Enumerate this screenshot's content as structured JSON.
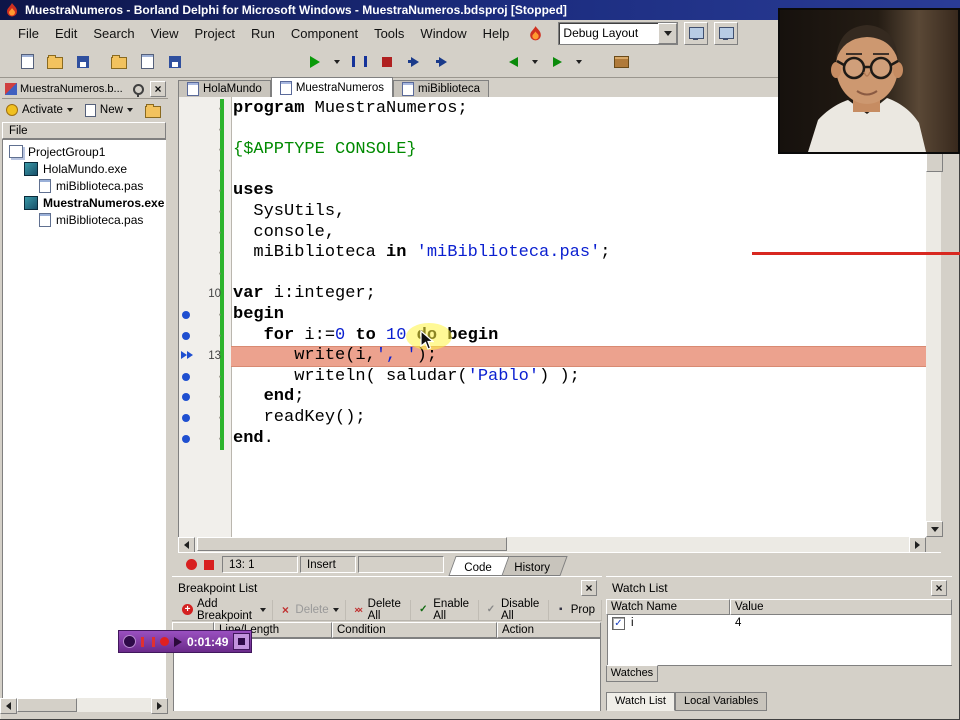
{
  "titlebar": {
    "title": "MuestraNumeros - Borland Delphi for Microsoft Windows - MuestraNumeros.bdsproj [Stopped]"
  },
  "menubar": {
    "items": [
      "File",
      "Edit",
      "Search",
      "View",
      "Project",
      "Run",
      "Component",
      "Tools",
      "Window",
      "Help"
    ],
    "layout_combo": "Debug Layout"
  },
  "toolbar": {
    "groups": [
      [
        {
          "name": "new-file-icon",
          "shape": "page"
        },
        {
          "name": "open-file-icon",
          "shape": "folder"
        },
        {
          "name": "save-file-icon",
          "shape": "floppy"
        }
      ],
      [
        {
          "name": "open-project-icon",
          "shape": "folder"
        },
        {
          "name": "add-file-icon",
          "shape": "page"
        },
        {
          "name": "save-all-icon",
          "shape": "floppy"
        }
      ],
      [
        {
          "name": "run-icon",
          "shape": "run",
          "caret": true
        },
        {
          "name": "pause-icon",
          "shape": "pause"
        },
        {
          "name": "program-reset-icon",
          "shape": "stop"
        },
        {
          "name": "step-over-icon",
          "shape": "step"
        },
        {
          "name": "trace-into-icon",
          "shape": "step"
        }
      ],
      [
        {
          "name": "navigate-back-icon",
          "shape": "back",
          "caret": true
        },
        {
          "name": "navigate-forward-icon",
          "shape": "fwd",
          "caret": true
        }
      ],
      [
        {
          "name": "package-icon",
          "shape": "package"
        }
      ]
    ]
  },
  "project_panel": {
    "title": "MuestraNumeros.b...",
    "toolbar_buttons": [
      "Activate",
      "New"
    ],
    "column_header": "File",
    "tree": [
      {
        "label": "ProjectGroup1",
        "level": 0,
        "icon": "project-group-icon",
        "bold": false
      },
      {
        "label": "HolaMundo.exe",
        "level": 1,
        "icon": "exe-icon",
        "bold": false
      },
      {
        "label": "miBiblioteca.pas",
        "level": 2,
        "icon": "pas-icon",
        "bold": false
      },
      {
        "label": "MuestraNumeros.exe",
        "level": 1,
        "icon": "exe-icon",
        "bold": true
      },
      {
        "label": "miBiblioteca.pas",
        "level": 2,
        "icon": "pas-icon",
        "bold": false
      }
    ]
  },
  "editor": {
    "tabs": [
      {
        "label": "HolaMundo",
        "active": false
      },
      {
        "label": "MuestraNumeros",
        "active": true
      },
      {
        "label": "miBiblioteca",
        "active": false
      }
    ],
    "code": {
      "gutter_dot": "·",
      "lines": [
        {
          "g": "",
          "m": "",
          "hl": false,
          "segs": [
            [
              "k",
              "program"
            ],
            [
              "i",
              " MuestraNumeros;"
            ]
          ]
        },
        {
          "g": "",
          "m": "",
          "hl": false,
          "segs": []
        },
        {
          "g": "",
          "m": "",
          "hl": false,
          "segs": [
            [
              "d",
              "{$APPTYPE CONSOLE}"
            ]
          ]
        },
        {
          "g": "",
          "m": "",
          "hl": false,
          "segs": []
        },
        {
          "g": "",
          "m": "",
          "hl": false,
          "segs": [
            [
              "k",
              "uses"
            ]
          ]
        },
        {
          "g": "",
          "m": "",
          "hl": false,
          "segs": [
            [
              "i",
              "  SysUtils,"
            ]
          ]
        },
        {
          "g": "",
          "m": "",
          "hl": false,
          "segs": [
            [
              "i",
              "  console,"
            ]
          ]
        },
        {
          "g": "",
          "m": "",
          "hl": false,
          "segs": [
            [
              "i",
              "  miBiblioteca "
            ],
            [
              "k",
              "in"
            ],
            [
              "i",
              " "
            ],
            [
              "s",
              "'miBiblioteca.pas'"
            ],
            [
              "i",
              ";"
            ]
          ]
        },
        {
          "g": "",
          "m": "",
          "hl": false,
          "segs": []
        },
        {
          "g": "10",
          "m": "",
          "hl": false,
          "segs": [
            [
              "k",
              "var"
            ],
            [
              "i",
              " i:integer;"
            ]
          ]
        },
        {
          "g": "",
          "m": "dot",
          "hl": false,
          "segs": [
            [
              "k",
              "begin"
            ]
          ]
        },
        {
          "g": "",
          "m": "dot",
          "hl": false,
          "segs": [
            [
              "i",
              "   "
            ],
            [
              "k",
              "for"
            ],
            [
              "i",
              " i:="
            ],
            [
              "n",
              "0"
            ],
            [
              "i",
              " "
            ],
            [
              "k",
              "to"
            ],
            [
              "i",
              " "
            ],
            [
              "n",
              "10"
            ],
            [
              "i",
              " "
            ],
            [
              "k",
              "do"
            ],
            [
              "i",
              " "
            ],
            [
              "k",
              "begin"
            ]
          ]
        },
        {
          "g": "13",
          "m": "arrow",
          "hl": true,
          "segs": [
            [
              "i",
              "      write(i,"
            ],
            [
              "s",
              "', '"
            ],
            [
              "i",
              ");"
            ]
          ]
        },
        {
          "g": "",
          "m": "dot",
          "hl": false,
          "segs": [
            [
              "i",
              "      writeln( saludar("
            ],
            [
              "s",
              "'Pablo'"
            ],
            [
              "i",
              ") );"
            ]
          ]
        },
        {
          "g": "",
          "m": "dot",
          "hl": false,
          "segs": [
            [
              "i",
              "   "
            ],
            [
              "k",
              "end"
            ],
            [
              "i",
              ";"
            ]
          ]
        },
        {
          "g": "",
          "m": "dot",
          "hl": false,
          "segs": [
            [
              "i",
              "   readKey();"
            ]
          ]
        },
        {
          "g": "",
          "m": "dot",
          "hl": false,
          "segs": [
            [
              "k",
              "end"
            ],
            [
              "i",
              "."
            ]
          ]
        }
      ]
    },
    "status": {
      "caret": "13: 1",
      "mode": "Insert"
    },
    "bottom_tabs": [
      "Code",
      "History"
    ]
  },
  "breakpoint_panel": {
    "title": "Breakpoint List",
    "toolbar": [
      {
        "label": "Add Breakpoint",
        "icon": "add-breakpoint-icon",
        "ic": "plus",
        "caret": true,
        "disabled": false
      },
      {
        "label": "Delete",
        "icon": "delete-breakpoint-icon",
        "ic": "x",
        "caret": true,
        "disabled": true
      },
      {
        "label": "Delete All",
        "icon": "delete-all-icon",
        "ic": "xx",
        "caret": false,
        "disabled": false
      },
      {
        "label": "Enable All",
        "icon": "enable-all-icon",
        "ic": "check",
        "caret": false,
        "disabled": false
      },
      {
        "label": "Disable All",
        "icon": "disable-all-icon",
        "ic": "graycheck",
        "caret": false,
        "disabled": false
      },
      {
        "label": "Prop",
        "icon": "properties-icon",
        "ic": "prop",
        "caret": false,
        "disabled": false
      }
    ],
    "columns": [
      "",
      "Line/Length",
      "Condition",
      "Action"
    ]
  },
  "watch_panel": {
    "title": "Watch List",
    "columns": [
      "Watch Name",
      "Value"
    ],
    "rows": [
      {
        "checked": true,
        "name": "i",
        "value": "4"
      }
    ],
    "inner_tab": "Watches",
    "dock_tabs": [
      "Watch List",
      "Local Variables"
    ]
  },
  "media_overlay": {
    "time": "0:01:49"
  },
  "colors": {
    "titlebar_blue": "#1c2d80",
    "window_gray": "#d4d0c8",
    "highlight_line_salmon": "#eca28e",
    "literal_blue": "#0a1fd0",
    "directive_green": "#008a00",
    "change_bar_green": "#2cb42c",
    "marker_blue": "#1f4fd0",
    "divider_red": "#d82820",
    "media_purple": "#7b2d94"
  }
}
